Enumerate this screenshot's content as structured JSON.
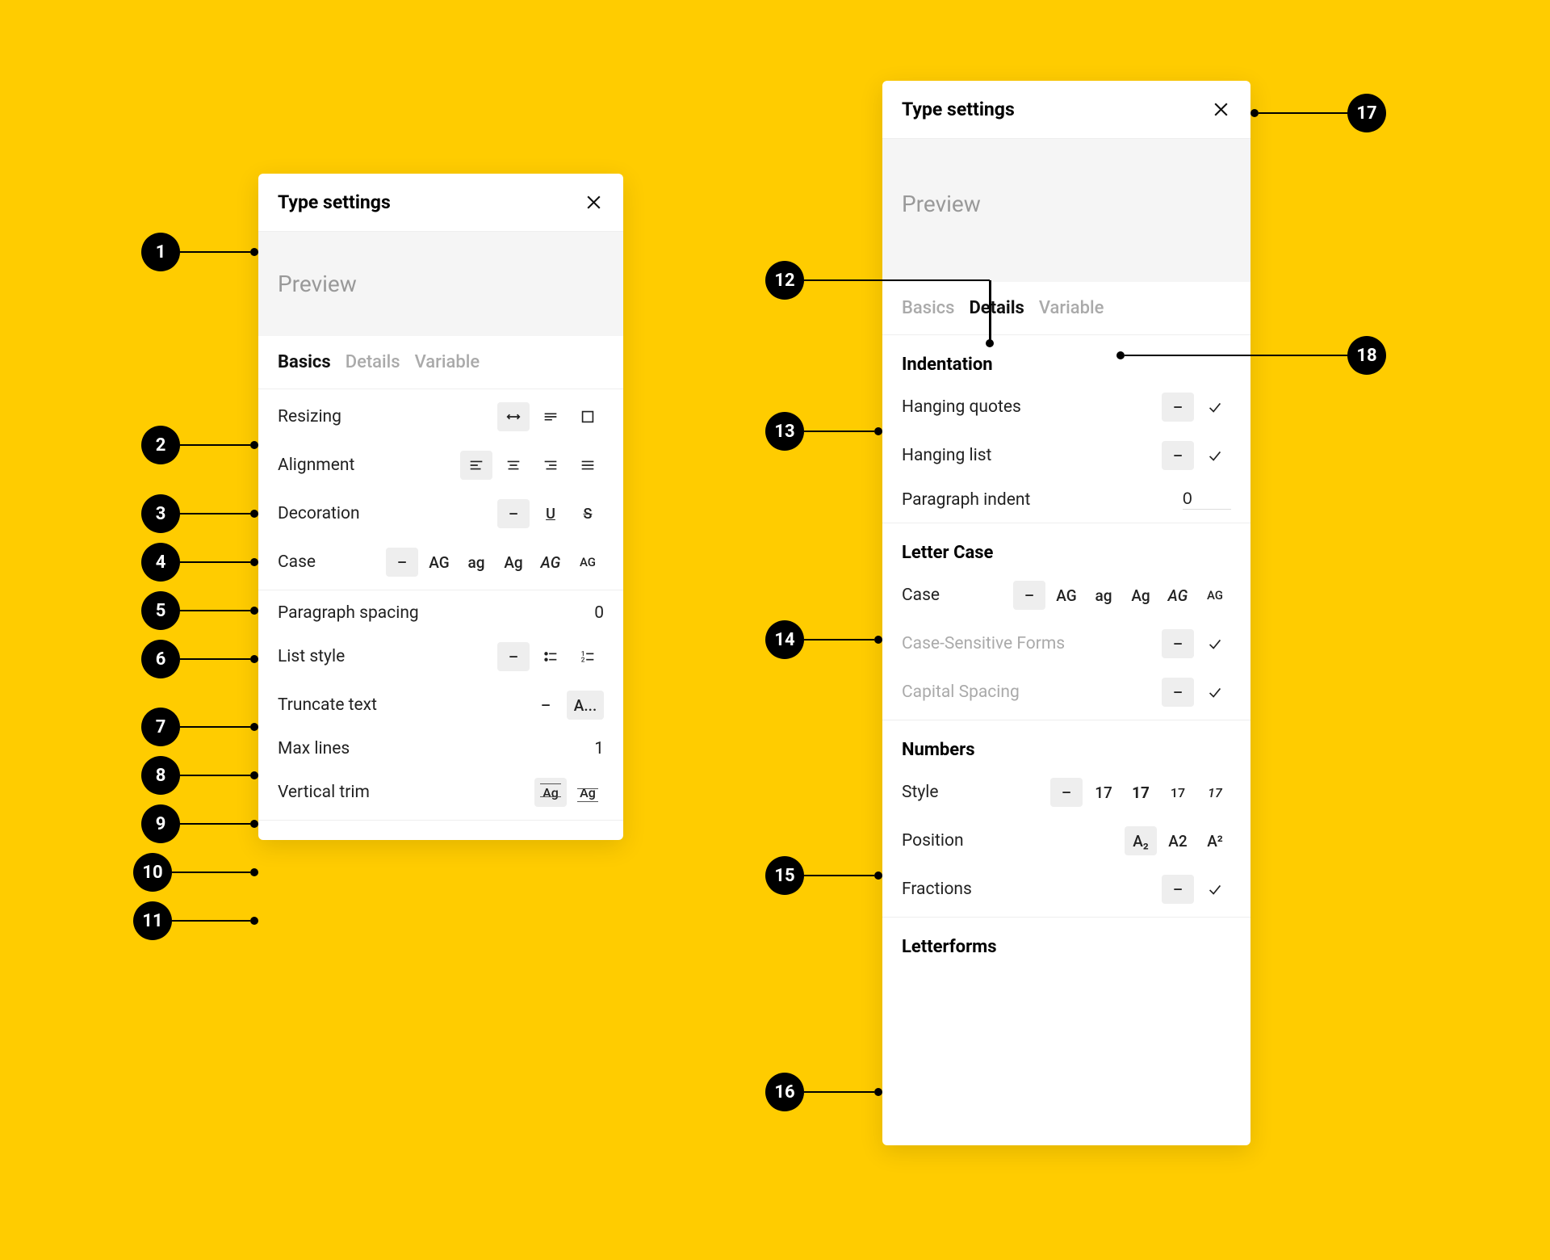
{
  "title": "Type settings",
  "close_icon": "close",
  "preview_label": "Preview",
  "tabs": {
    "basics": "Basics",
    "details": "Details",
    "variable": "Variable"
  },
  "left": {
    "active_tab": "Basics",
    "resizing_label": "Resizing",
    "alignment_label": "Alignment",
    "decoration_label": "Decoration",
    "case_label": "Case",
    "case_opts": {
      "dash": "–",
      "upper": "AG",
      "lower": "ag",
      "title": "Ag",
      "small": "AG",
      "small2": "AG"
    },
    "paragraph_spacing_label": "Paragraph spacing",
    "paragraph_spacing_value": "0",
    "list_style_label": "List style",
    "truncate_label": "Truncate text",
    "truncate_opts": {
      "dash": "–",
      "ellip": "A..."
    },
    "maxlines_label": "Max lines",
    "maxlines_value": "1",
    "vtrim_label": "Vertical trim",
    "vtrim_opts": {
      "cap": "Ag",
      "base": "Ag"
    }
  },
  "right": {
    "active_tab": "Details",
    "indentation": {
      "header": "Indentation",
      "hanging_quotes": "Hanging quotes",
      "hanging_list": "Hanging list",
      "paragraph_indent": "Paragraph indent",
      "paragraph_indent_value": "0"
    },
    "letter_case": {
      "header": "Letter Case",
      "case": "Case",
      "case_opts": {
        "dash": "–",
        "upper": "AG",
        "lower": "ag",
        "title": "Ag",
        "small": "AG",
        "small2": "AG"
      },
      "csf": "Case-Sensitive Forms",
      "cap_spacing": "Capital Spacing"
    },
    "numbers": {
      "header": "Numbers",
      "style": "Style",
      "style_opts": {
        "dash": "–",
        "a": "17",
        "b": "17",
        "c": "17",
        "d": "17"
      },
      "position": "Position",
      "position_opts": {
        "sub": "A₂",
        "norm": "A2",
        "sup": "A²"
      },
      "fractions": "Fractions"
    },
    "letterforms": {
      "header": "Letterforms"
    }
  },
  "toggle": {
    "dash": "–",
    "check": "✓"
  },
  "markers": {
    "m1": "1",
    "m2": "2",
    "m3": "3",
    "m4": "4",
    "m5": "5",
    "m6": "6",
    "m7": "7",
    "m8": "8",
    "m9": "9",
    "m10": "10",
    "m11": "11",
    "m12": "12",
    "m13": "13",
    "m14": "14",
    "m15": "15",
    "m16": "16",
    "m17": "17",
    "m18": "18"
  }
}
